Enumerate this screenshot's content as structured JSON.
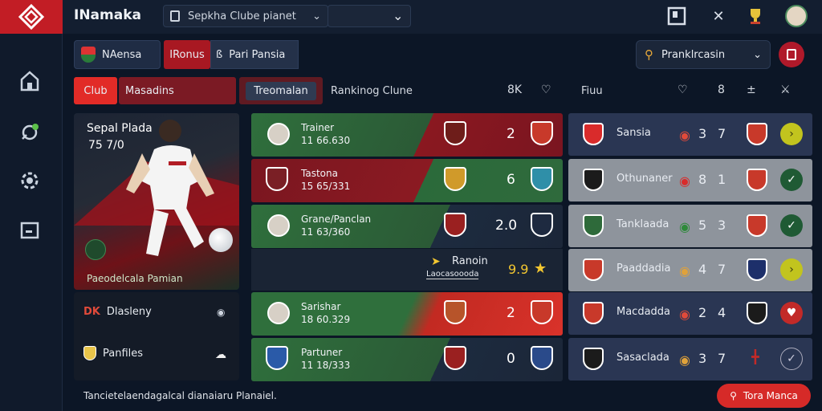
{
  "app": {
    "title": "INamaka"
  },
  "topbar": {
    "search_text": "Sepkha Clube pianet"
  },
  "teambar": {
    "team_label": "NAensa",
    "tab_red": "IRonus",
    "tab_panel_prefix": "ß",
    "tab_panel": "Pari Pansia"
  },
  "right_search": {
    "text": "Pranklrcasin"
  },
  "tabs": {
    "club": "Club",
    "mode": "Masadins",
    "tour": "Treomalan",
    "ranking": "Rankinog Clune",
    "count": "8K"
  },
  "right_header": {
    "title": "Fiuu"
  },
  "player": {
    "name": "Sepal Plada",
    "number": "75 7/0",
    "footer": "Paeodelcala Pamian"
  },
  "player_list": [
    {
      "prefix": "DK",
      "label": "Dlasleny"
    },
    {
      "prefix": "",
      "label": "Panfiles"
    }
  ],
  "matches": [
    {
      "name": "Trainer",
      "sub": "11 66.630",
      "score": "2"
    },
    {
      "name": "Tastona",
      "sub": "15 65/331",
      "score": "6"
    },
    {
      "name": "Grane/Panclan",
      "sub": "11 63/360",
      "score": "2.0"
    },
    {
      "name": "Sarishar",
      "sub": "18 60.329",
      "score": "2"
    },
    {
      "name": "Partuner",
      "sub": "11 18/333",
      "score": "0"
    }
  ],
  "ranking_banner": {
    "label": "Ranoin",
    "sub": "Laocasoooda",
    "score": "9.9"
  },
  "standings": [
    {
      "name": "Sansia",
      "a": "3",
      "b": "7"
    },
    {
      "name": "Othunaner",
      "a": "8",
      "b": "1"
    },
    {
      "name": "Tanklaada",
      "a": "5",
      "b": "3"
    },
    {
      "name": "Paaddadia",
      "a": "4",
      "b": "7"
    },
    {
      "name": "Macdadda",
      "a": "2",
      "b": "4"
    },
    {
      "name": "Sasaclada",
      "a": "3",
      "b": "7"
    }
  ],
  "footer": {
    "text": "Tancietelaendagalcal dianaiaru Planaiel.",
    "cta": "Tora Manca"
  },
  "colors": {
    "accent_red": "#d62a28",
    "panel_dark": "#131e30",
    "row_gray": "#8e949c",
    "row_navy": "#2a3653",
    "check_green": "#1f5a34",
    "lime": "#c2c41e"
  }
}
